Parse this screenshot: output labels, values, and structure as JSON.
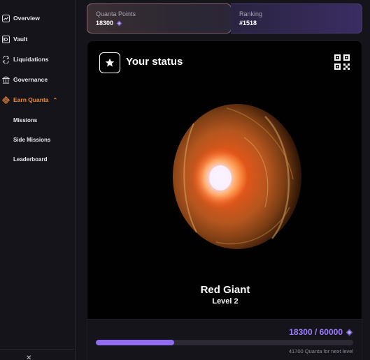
{
  "sidebar": {
    "items": [
      {
        "label": "Overview",
        "icon": "chart-line-icon"
      },
      {
        "label": "Vault",
        "icon": "vault-icon"
      },
      {
        "label": "Liquidations",
        "icon": "liquidations-icon"
      },
      {
        "label": "Governance",
        "icon": "bank-icon"
      },
      {
        "label": "Earn Quanta",
        "icon": "diamond-icon",
        "active": true
      },
      {
        "label": "Missions"
      },
      {
        "label": "Side Missions"
      },
      {
        "label": "Leaderboard"
      }
    ]
  },
  "points_card": {
    "label": "Quanta Points",
    "value": "18300"
  },
  "ranking_card": {
    "label": "Ranking",
    "value": "#1518"
  },
  "status": {
    "title": "Your status",
    "tier_name": "Red Giant",
    "tier_level": "Level 2",
    "progress_text": "18300 / 60000",
    "progress_fraction": 0.305,
    "progress_note": "41700 Quanta for next level"
  },
  "colors": {
    "accent_orange": "#f08a2e",
    "accent_purple": "#8f6cf2"
  }
}
